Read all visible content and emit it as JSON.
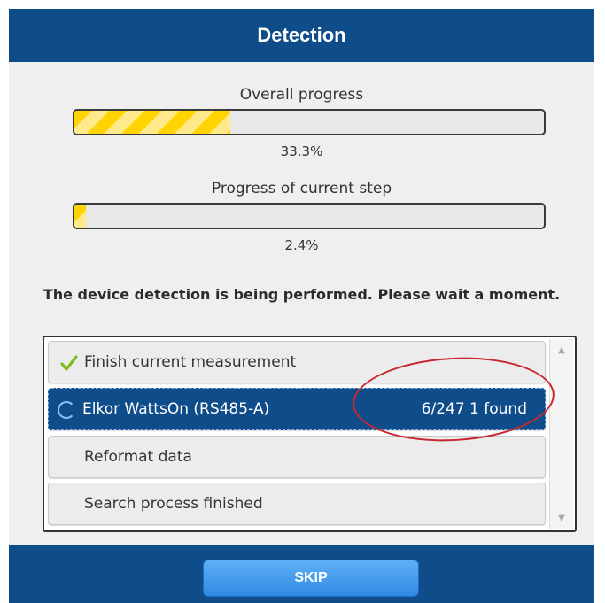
{
  "dialog": {
    "title": "Detection"
  },
  "overall_progress": {
    "label": "Overall progress",
    "value_text": "33.3%",
    "value": 33.3
  },
  "step_progress": {
    "label": "Progress of current step",
    "value_text": "2.4%",
    "value": 2.4
  },
  "message": "The device detection is being performed. Please wait a moment.",
  "steps": [
    {
      "label": "Finish current measurement",
      "state": "done",
      "icon": "check-icon"
    },
    {
      "label": "Elkor WattsOn (RS485-A)",
      "state": "active",
      "icon": "spinner-icon",
      "count": "6/247 1 found"
    },
    {
      "label": "Reformat data",
      "state": "pending"
    },
    {
      "label": "Search process finished",
      "state": "pending"
    }
  ],
  "footer": {
    "skip_label": "SKIP"
  },
  "colors": {
    "header_bg": "#0f4c8a",
    "progress_fill": "#ffd400",
    "active_row": "#0f4c8a",
    "annotation": "#c8282e",
    "skip_button": "#2f8ae3"
  }
}
